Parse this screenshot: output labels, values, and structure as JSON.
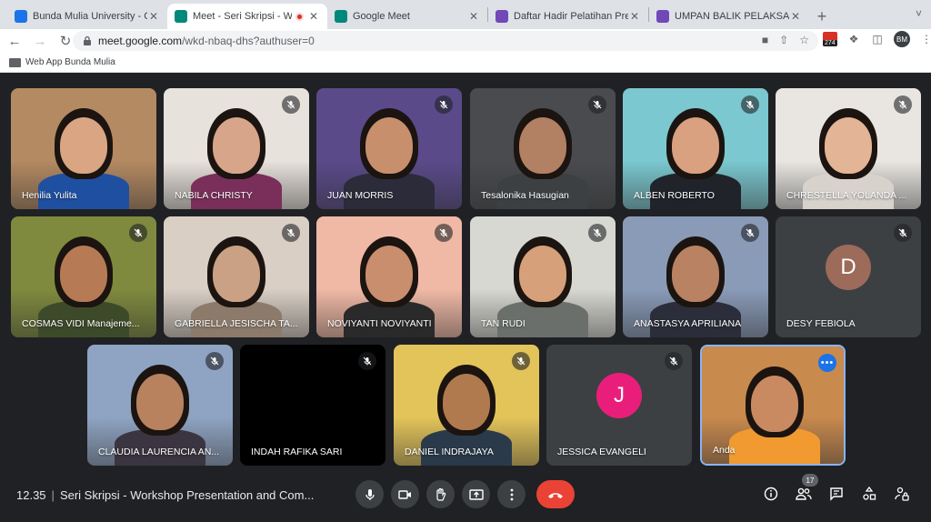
{
  "browser": {
    "tabs": [
      {
        "title": "Bunda Mulia University - Calen",
        "icon": "google-calendar-icon",
        "color": "#1a73e8",
        "active": false
      },
      {
        "title": "Meet - Seri Skripsi - Works",
        "icon": "google-meet-icon",
        "color": "#00897b",
        "active": true,
        "recording": true
      },
      {
        "title": "Google Meet",
        "icon": "google-meet-icon",
        "color": "#00897b",
        "active": false
      },
      {
        "title": "Daftar Hadir Pelatihan Presentas",
        "icon": "google-forms-icon",
        "color": "#7248b9",
        "active": false
      },
      {
        "title": "UMPAN BALIK PELAKSANAAN",
        "icon": "google-forms-icon",
        "color": "#7248b9",
        "active": false
      }
    ],
    "url_host": "meet.google.com",
    "url_path": "/wkd-nbaq-dhs?authuser=0",
    "extension_badge": "274",
    "profile_initials": "BM",
    "bookmark": "Web App Bunda Mulia"
  },
  "participants": [
    {
      "name": "Henilia Yulita",
      "muted": false,
      "bg": "#b48a62",
      "skin": "#d9a582",
      "shirt": "#1f4fa0"
    },
    {
      "name": "NABILA CHRISTY",
      "muted": true,
      "bg": "#e8e2dc",
      "skin": "#d7a58a",
      "shirt": "#7a2f5a"
    },
    {
      "name": "JUAN MORRIS",
      "muted": true,
      "bg": "#5a4a8a",
      "skin": "#c88f6c",
      "shirt": "#2b2b3a"
    },
    {
      "name": "Tesalonika Hasugian",
      "muted": true,
      "bg": "#4a4b4f",
      "skin": "#b28062",
      "shirt": "#3c4043"
    },
    {
      "name": "ALBEN ROBERTO",
      "muted": true,
      "bg": "#7bc8d0",
      "skin": "#d9a17f",
      "shirt": "#20232a"
    },
    {
      "name": "CHRESTELLA YOLANDA ...",
      "muted": true,
      "bg": "#e9e6e2",
      "skin": "#e4b497",
      "shirt": "#d7d2cc"
    },
    {
      "name": "COSMAS VIDI Manajeme...",
      "muted": true,
      "bg": "#7f8a3e",
      "skin": "#b67a55",
      "shirt": "#3d4a2a"
    },
    {
      "name": "GABRIELLA JESISCHA TA...",
      "muted": true,
      "bg": "#d9cfc5",
      "skin": "#caa184",
      "shirt": "#8c7a6b"
    },
    {
      "name": "NOVIYANTI NOVIYANTI",
      "muted": true,
      "bg": "#f0b9a6",
      "skin": "#c98e6d",
      "shirt": "#2a2a2a"
    },
    {
      "name": "TAN RUDI",
      "muted": true,
      "bg": "#d8d8d2",
      "skin": "#d6a07a",
      "shirt": "#6b6f6c"
    },
    {
      "name": "ANASTASYA APRILIANA",
      "muted": true,
      "bg": "#8a9bb8",
      "skin": "#b98262",
      "shirt": "#2b2e3a"
    },
    {
      "name": "DESY FEBIOLA",
      "muted": true,
      "initial": "D",
      "initial_color": "#9c6b5a"
    },
    {
      "name": "CLAUDIA LAURENCIA AN...",
      "muted": true,
      "bg": "#8fa4c2",
      "skin": "#b9825f",
      "shirt": "#3a3540"
    },
    {
      "name": "INDAH RAFIKA SARI",
      "muted": true,
      "blank": true
    },
    {
      "name": "DANIEL INDRAJAYA",
      "muted": true,
      "bg": "#e3c45a",
      "skin": "#b07a4e",
      "shirt": "#2a3a4a"
    },
    {
      "name": "JESSICA EVANGELI",
      "muted": true,
      "initial": "J",
      "initial_color": "#e91e7a"
    },
    {
      "name": "Anda",
      "muted": false,
      "self": true,
      "bg": "#c98a4e",
      "skin": "#c98a62",
      "shirt": "#f09a30"
    }
  ],
  "meeting": {
    "time": "12.35",
    "title": "Seri Skripsi - Workshop Presentation and Com..."
  },
  "participant_count": "17"
}
